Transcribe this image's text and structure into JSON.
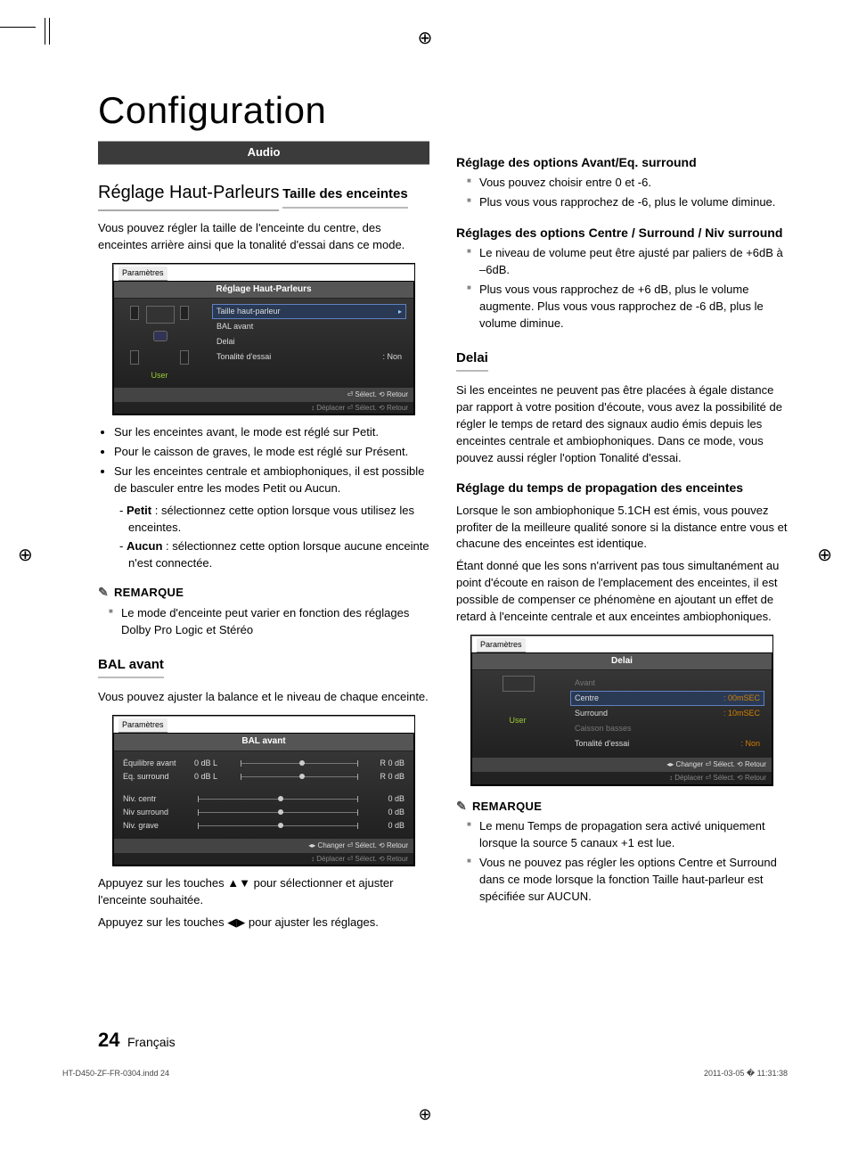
{
  "title": "Configuration",
  "ribbon": "Audio",
  "h_speaker": "Réglage Haut-Parleurs",
  "h_size": "Taille des enceintes",
  "p_size": "Vous pouvez régler la taille de l'enceinte du centre, des enceintes arrière ainsi que la tonalité d'essai dans ce mode.",
  "ui1": {
    "tab": "Paramètres",
    "title": "Réglage Haut-Parleurs",
    "user": "User",
    "rows": [
      {
        "label": "Taille haut-parleur",
        "value": "",
        "sel": true,
        "arrow": "▸"
      },
      {
        "label": "BAL avant",
        "value": ""
      },
      {
        "label": "Delai",
        "value": ""
      },
      {
        "label": "Tonalité d'essai",
        "value": ":   Non"
      }
    ],
    "foot1": "⏎ Sélect.   ⟲ Retour",
    "foot2": "↕ Déplacer   ⏎ Sélect.   ⟲ Retour"
  },
  "size_bullets": [
    "Sur les enceintes avant, le mode est réglé sur Petit.",
    "Pour le caisson de graves, le mode est réglé sur Présent.",
    "Sur les enceintes centrale et ambiophoniques, il est possible de basculer entre les modes Petit ou Aucun."
  ],
  "size_defs": [
    {
      "term": "Petit",
      "text": " : sélectionnez cette option lorsque vous utilisez les enceintes."
    },
    {
      "term": "Aucun",
      "text": " : sélectionnez cette option lorsque aucune enceinte n'est connectée."
    }
  ],
  "remark1_h": "REMARQUE",
  "remark1": [
    "Le mode d'enceinte peut varier en fonction des réglages Dolby Pro Logic et Stéréo"
  ],
  "h_bal": "BAL avant",
  "p_bal": "Vous pouvez ajuster la balance et le niveau de chaque enceinte.",
  "ui2": {
    "tab": "Paramètres",
    "title": "BAL avant",
    "rows_top": [
      {
        "label": "Équilibre avant",
        "l": "0 dB L",
        "r": "R  0 dB",
        "dot": 50,
        "boxed": true
      },
      {
        "label": "Eq. surround",
        "l": "0 dB L",
        "r": "R  0 dB",
        "dot": 50
      }
    ],
    "rows_bot": [
      {
        "label": "Niv. centr",
        "r": "0 dB",
        "dot": 50
      },
      {
        "label": "Niv surround",
        "r": "0 dB",
        "dot": 50
      },
      {
        "label": "Niv. grave",
        "r": "0 dB",
        "dot": 50
      }
    ],
    "foot1": "◂▸ Changer  ⏎ Sélect.   ⟲ Retour",
    "foot2": "↕ Déplacer   ⏎ Sélect.   ⟲ Retour"
  },
  "p_bal_use1": "Appuyez sur les touches ▲▼ pour sélectionner et ajuster l'enceinte souhaitée.",
  "p_bal_use2": "Appuyez sur les touches ◀▶ pour ajuster les réglages.",
  "col2": {
    "h_front": "Réglage des options Avant/Eq. surround",
    "front_b": [
      "Vous pouvez choisir entre 0 et -6.",
      "Plus vous vous rapprochez de -6, plus le volume diminue."
    ],
    "h_csr": "Réglages des options Centre / Surround / Niv surround",
    "csr_b": [
      "Le niveau de volume peut être ajusté par paliers de +6dB à –6dB.",
      "Plus vous vous rapprochez de +6 dB, plus le volume augmente. Plus vous vous rapprochez de -6 dB, plus le volume diminue."
    ],
    "h_delai": "Delai",
    "p_delai": "Si les enceintes ne peuvent pas être placées à égale distance par rapport à votre position d'écoute, vous avez la possibilité de régler le temps de retard des signaux audio émis depuis les enceintes centrale et ambiophoniques. Dans ce mode, vous pouvez aussi régler l'option Tonalité d'essai.",
    "h_prop": "Réglage du temps de propagation des enceintes",
    "p_prop1": "Lorsque le son ambiophonique 5.1CH est émis, vous pouvez profiter de la meilleure qualité sonore si la distance entre vous et chacune des enceintes est identique.",
    "p_prop2": "Étant donné que les sons n'arrivent pas tous simultanément au point d'écoute en raison de l'emplacement des enceintes, il est possible de compenser ce phénomène en ajoutant un effet de retard à l'enceinte centrale et aux enceintes  ambiophoniques.",
    "remark_h": "REMARQUE",
    "remark": [
      "Le menu Temps de propagation sera activé uniquement lorsque la source 5 canaux +1 est lue.",
      "Vous ne pouvez pas régler les options Centre et Surround dans ce mode lorsque la fonction Taille haut-parleur est spécifiée sur AUCUN."
    ]
  },
  "ui3": {
    "tab": "Paramètres",
    "title": "Delai",
    "user": "User",
    "rows": [
      {
        "label": "Avant",
        "value": "",
        "dim": true
      },
      {
        "label": "Centre",
        "value": ":  00mSEC",
        "sel": true
      },
      {
        "label": "Surround",
        "value": ":  10mSEC"
      },
      {
        "label": "Caisson basses",
        "value": "",
        "dim": true
      },
      {
        "label": "Tonalité d'essai",
        "value": ":  Non"
      }
    ],
    "foot1": "◂▸ Changer  ⏎ Sélect.   ⟲ Retour",
    "foot2": "↕ Déplacer   ⏎ Sélect.   ⟲ Retour"
  },
  "page_num": "24",
  "page_lang": "Français",
  "print_left": "HT-D450-ZF-FR-0304.indd   24",
  "print_right": "2011-03-05   � 11:31:38"
}
